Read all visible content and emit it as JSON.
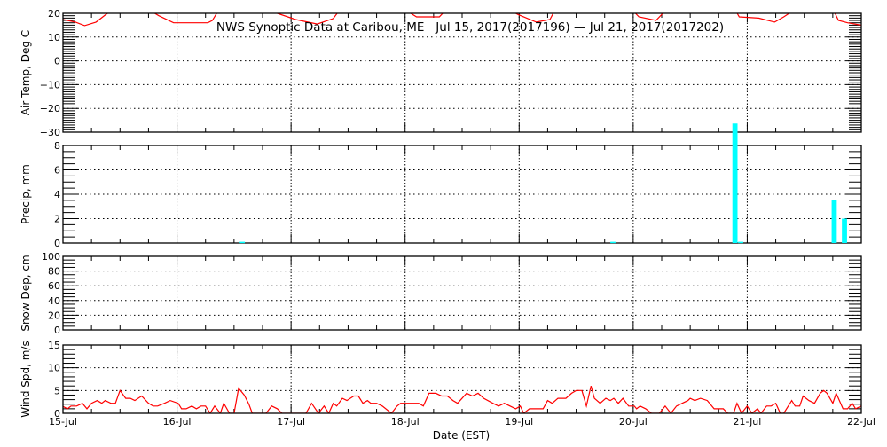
{
  "title": "NWS Synoptic Data at Caribou, ME   Jul 15, 2017(2017196) — Jul 21, 2017(2017202)",
  "colors": {
    "line": "#ff0000",
    "bar": "#00ffff",
    "axis": "#000000"
  },
  "chart_data": [
    {
      "type": "line",
      "id": "temp",
      "ylabel": "Air Temp, Deg C",
      "ylim": [
        -30,
        20
      ],
      "yticks": [
        20,
        10,
        0,
        -10,
        -20,
        -30
      ],
      "yminor": 1,
      "grid": true,
      "x_unit": "days since Jul 15 00:00 EST",
      "points": [
        [
          0,
          17.4
        ],
        [
          0.11,
          16.3
        ],
        [
          0.19,
          14.8
        ],
        [
          0.29,
          16.3
        ],
        [
          0.37,
          19.3
        ],
        [
          0.42,
          21
        ],
        [
          0.6,
          23
        ],
        [
          0.77,
          21
        ],
        [
          0.84,
          19
        ],
        [
          0.97,
          16
        ],
        [
          1.27,
          16
        ],
        [
          1.31,
          17
        ],
        [
          1.36,
          21
        ],
        [
          1.6,
          23
        ],
        [
          1.82,
          21
        ],
        [
          1.88,
          20
        ],
        [
          2.04,
          17.4
        ],
        [
          2.23,
          15.5
        ],
        [
          2.37,
          17.8
        ],
        [
          2.42,
          21
        ],
        [
          2.7,
          23
        ],
        [
          3.0,
          21
        ],
        [
          3.05,
          20
        ],
        [
          3.1,
          18.5
        ],
        [
          3.3,
          18.5
        ],
        [
          3.35,
          21
        ],
        [
          3.6,
          23
        ],
        [
          3.93,
          21
        ],
        [
          3.99,
          19.5
        ],
        [
          4.15,
          16.3
        ],
        [
          4.27,
          17.4
        ],
        [
          4.31,
          21
        ],
        [
          4.6,
          23
        ],
        [
          5.0,
          21
        ],
        [
          5.05,
          18.5
        ],
        [
          5.2,
          17
        ],
        [
          5.28,
          21
        ],
        [
          5.6,
          23
        ],
        [
          5.9,
          21
        ],
        [
          5.93,
          18.5
        ],
        [
          6.1,
          18
        ],
        [
          6.24,
          16.3
        ],
        [
          6.32,
          18.5
        ],
        [
          6.4,
          21
        ],
        [
          6.6,
          22
        ],
        [
          6.76,
          21
        ],
        [
          6.8,
          17
        ],
        [
          6.88,
          16
        ],
        [
          7.0,
          15
        ]
      ]
    },
    {
      "type": "bar",
      "id": "precip",
      "ylabel": "Precip, mm",
      "ylim": [
        0,
        8
      ],
      "yticks": [
        0,
        2,
        4,
        6,
        8
      ],
      "yminor": 0.5,
      "grid": true,
      "bar_width_days": 0.045,
      "points": [
        [
          1.55,
          0.1
        ],
        [
          4.8,
          0.1
        ],
        [
          5.87,
          9.8
        ],
        [
          5.92,
          0.1
        ],
        [
          6.74,
          3.5
        ],
        [
          6.83,
          2.0
        ]
      ]
    },
    {
      "type": "line",
      "id": "snow",
      "ylabel": "Snow Dep, cm",
      "ylim": [
        0,
        100
      ],
      "yticks": [
        0,
        20,
        40,
        60,
        80,
        100
      ],
      "yminor": 5,
      "grid": true,
      "points": []
    },
    {
      "type": "line",
      "id": "wind",
      "ylabel": "Wind Spd, m/s",
      "ylim": [
        0,
        15
      ],
      "yticks": [
        0,
        5,
        10,
        15
      ],
      "yminor": 1,
      "grid": true,
      "points": [
        [
          0,
          1.5
        ],
        [
          0.04,
          1
        ],
        [
          0.07,
          1.6
        ],
        [
          0.12,
          1.6
        ],
        [
          0.17,
          2.2
        ],
        [
          0.21,
          1
        ],
        [
          0.25,
          2.2
        ],
        [
          0.3,
          2.8
        ],
        [
          0.34,
          2.2
        ],
        [
          0.37,
          2.8
        ],
        [
          0.42,
          2.2
        ],
        [
          0.46,
          2.2
        ],
        [
          0.5,
          5
        ],
        [
          0.55,
          3.3
        ],
        [
          0.59,
          3.3
        ],
        [
          0.63,
          2.8
        ],
        [
          0.69,
          3.8
        ],
        [
          0.75,
          2.2
        ],
        [
          0.79,
          1.6
        ],
        [
          0.83,
          1.6
        ],
        [
          0.89,
          2.2
        ],
        [
          0.94,
          2.8
        ],
        [
          1.01,
          2.2
        ],
        [
          1.04,
          1
        ],
        [
          1.08,
          1
        ],
        [
          1.13,
          1.6
        ],
        [
          1.17,
          1
        ],
        [
          1.21,
          1.6
        ],
        [
          1.25,
          1.6
        ],
        [
          1.29,
          0
        ],
        [
          1.33,
          1.6
        ],
        [
          1.38,
          0
        ],
        [
          1.41,
          2.2
        ],
        [
          1.46,
          0
        ],
        [
          1.5,
          0
        ],
        [
          1.54,
          5.5
        ],
        [
          1.59,
          4
        ],
        [
          1.63,
          2
        ],
        [
          1.66,
          0
        ],
        [
          1.78,
          0
        ],
        [
          1.83,
          1.6
        ],
        [
          1.88,
          1
        ],
        [
          1.92,
          0
        ],
        [
          2.13,
          0
        ],
        [
          2.18,
          2.2
        ],
        [
          2.24,
          0
        ],
        [
          2.29,
          1.6
        ],
        [
          2.33,
          0
        ],
        [
          2.37,
          2.2
        ],
        [
          2.4,
          1.6
        ],
        [
          2.45,
          3.3
        ],
        [
          2.49,
          2.8
        ],
        [
          2.55,
          3.8
        ],
        [
          2.59,
          3.8
        ],
        [
          2.63,
          2.2
        ],
        [
          2.67,
          2.8
        ],
        [
          2.7,
          2.2
        ],
        [
          2.75,
          2.2
        ],
        [
          2.8,
          1.6
        ],
        [
          2.88,
          0
        ],
        [
          2.93,
          1.6
        ],
        [
          2.96,
          2.2
        ],
        [
          3.12,
          2.2
        ],
        [
          3.16,
          1.6
        ],
        [
          3.21,
          4.4
        ],
        [
          3.27,
          4.4
        ],
        [
          3.32,
          3.8
        ],
        [
          3.37,
          3.8
        ],
        [
          3.42,
          2.8
        ],
        [
          3.46,
          2.2
        ],
        [
          3.54,
          4.4
        ],
        [
          3.59,
          3.8
        ],
        [
          3.64,
          4.4
        ],
        [
          3.69,
          3.3
        ],
        [
          3.77,
          2.2
        ],
        [
          3.82,
          1.6
        ],
        [
          3.87,
          2.2
        ],
        [
          3.92,
          1.6
        ],
        [
          3.97,
          1
        ],
        [
          4.01,
          1.6
        ],
        [
          4.04,
          0
        ],
        [
          4.09,
          1
        ],
        [
          4.21,
          1
        ],
        [
          4.25,
          2.8
        ],
        [
          4.29,
          2.2
        ],
        [
          4.34,
          3.3
        ],
        [
          4.41,
          3.3
        ],
        [
          4.46,
          4.4
        ],
        [
          4.5,
          5
        ],
        [
          4.55,
          5
        ],
        [
          4.59,
          1.6
        ],
        [
          4.63,
          6
        ],
        [
          4.66,
          3.3
        ],
        [
          4.71,
          2.2
        ],
        [
          4.76,
          3.3
        ],
        [
          4.8,
          2.8
        ],
        [
          4.83,
          3.3
        ],
        [
          4.87,
          2.2
        ],
        [
          4.91,
          3.3
        ],
        [
          4.96,
          1.6
        ],
        [
          5.01,
          1.6
        ],
        [
          5.03,
          1
        ],
        [
          5.06,
          1.6
        ],
        [
          5.11,
          1
        ],
        [
          5.16,
          0
        ],
        [
          5.23,
          0
        ],
        [
          5.28,
          1.6
        ],
        [
          5.33,
          0
        ],
        [
          5.38,
          1.6
        ],
        [
          5.43,
          2.2
        ],
        [
          5.48,
          2.8
        ],
        [
          5.5,
          3.3
        ],
        [
          5.54,
          2.8
        ],
        [
          5.59,
          3.3
        ],
        [
          5.65,
          2.8
        ],
        [
          5.71,
          1
        ],
        [
          5.79,
          1
        ],
        [
          5.83,
          0
        ],
        [
          5.88,
          0
        ],
        [
          5.91,
          2.2
        ],
        [
          5.95,
          0
        ],
        [
          6.0,
          1.6
        ],
        [
          6.04,
          0
        ],
        [
          6.09,
          1
        ],
        [
          6.12,
          0
        ],
        [
          6.17,
          1.6
        ],
        [
          6.21,
          1.6
        ],
        [
          6.25,
          2.2
        ],
        [
          6.29,
          0
        ],
        [
          6.32,
          0
        ],
        [
          6.39,
          2.8
        ],
        [
          6.42,
          1.6
        ],
        [
          6.46,
          1.6
        ],
        [
          6.49,
          3.8
        ],
        [
          6.54,
          2.8
        ],
        [
          6.59,
          2.2
        ],
        [
          6.64,
          4.4
        ],
        [
          6.67,
          5
        ],
        [
          6.7,
          4.4
        ],
        [
          6.75,
          2.2
        ],
        [
          6.78,
          4.4
        ],
        [
          6.84,
          1
        ],
        [
          6.88,
          1
        ],
        [
          6.92,
          2.2
        ],
        [
          6.95,
          1
        ],
        [
          7.0,
          1.6
        ]
      ]
    }
  ],
  "xaxis": {
    "label": "Date (EST)",
    "ticks": [
      "15-Jul",
      "16-Jul",
      "17-Jul",
      "18-Jul",
      "19-Jul",
      "20-Jul",
      "21-Jul",
      "22-Jul"
    ],
    "range_days": [
      0,
      7
    ],
    "minor_hours": 6
  }
}
